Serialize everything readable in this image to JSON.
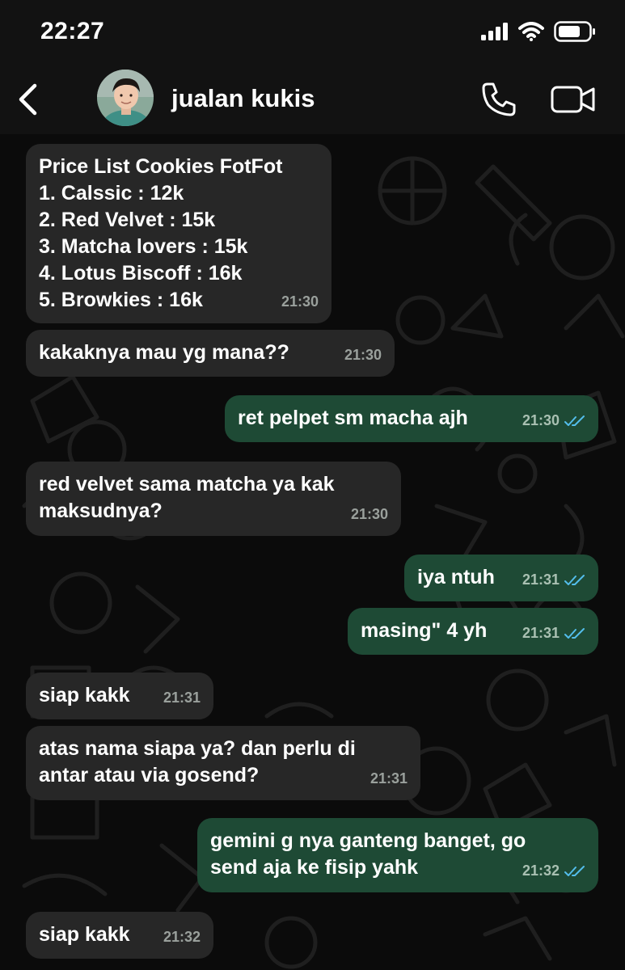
{
  "status_bar": {
    "time": "22:27"
  },
  "header": {
    "contact_name": "jualan kukis"
  },
  "colors": {
    "incoming_bubble": "#272727",
    "outgoing_bubble": "#1e4a35",
    "read_tick": "#53bdeb",
    "background": "#0b0b0b"
  },
  "icons": [
    "back-icon",
    "avatar",
    "phone-icon",
    "video-camera-icon",
    "double-check-icon",
    "signal-icon",
    "wifi-icon",
    "battery-icon"
  ],
  "messages": [
    {
      "direction": "in",
      "text": "Price List Cookies FotFot\n1. Calssic : 12k\n2. Red Velvet : 15k\n3. Matcha lovers : 15k\n4. Lotus Biscoff : 16k\n5. Browkies : 16k",
      "time": "21:30"
    },
    {
      "direction": "in",
      "text": "kakaknya mau yg mana??",
      "time": "21:30"
    },
    {
      "direction": "out",
      "text": "ret pelpet sm macha ajh",
      "time": "21:30",
      "read": true
    },
    {
      "direction": "in",
      "text": "red velvet sama matcha ya kak\nmaksudnya?",
      "time": "21:30"
    },
    {
      "direction": "out",
      "text": "iya ntuh",
      "time": "21:31",
      "read": true
    },
    {
      "direction": "out",
      "text": "masing\" 4 yh",
      "time": "21:31",
      "read": true
    },
    {
      "direction": "in",
      "text": "siap kakk",
      "time": "21:31"
    },
    {
      "direction": "in",
      "text": "atas nama siapa ya? dan perlu di\nantar atau via gosend?",
      "time": "21:31"
    },
    {
      "direction": "out",
      "text": "gemini g nya ganteng banget, go\nsend aja ke fisip yahk",
      "time": "21:32",
      "read": true
    },
    {
      "direction": "in",
      "text": "siap kakk",
      "time": "21:32"
    }
  ]
}
